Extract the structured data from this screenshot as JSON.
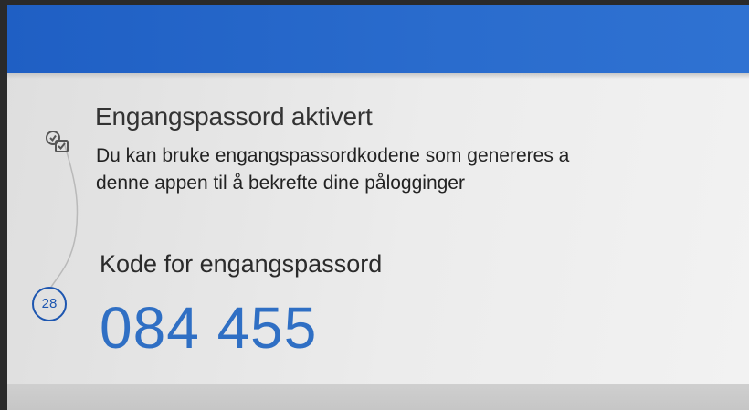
{
  "notification": {
    "title": "Engangspassord aktivert",
    "description_line1": "Du kan bruke engangspassordkodene som genereres a",
    "description_line2": "denne appen til å bekrefte dine pålogginger",
    "icon": "otp-check-icon"
  },
  "code": {
    "label": "Kode for engangspassord",
    "value": "084 455",
    "timer": "28",
    "timer_icon": "countdown-timer-icon"
  },
  "colors": {
    "header": "#2a6ccd",
    "code_text": "#2f6fc4",
    "timer": "#1d56b0"
  }
}
